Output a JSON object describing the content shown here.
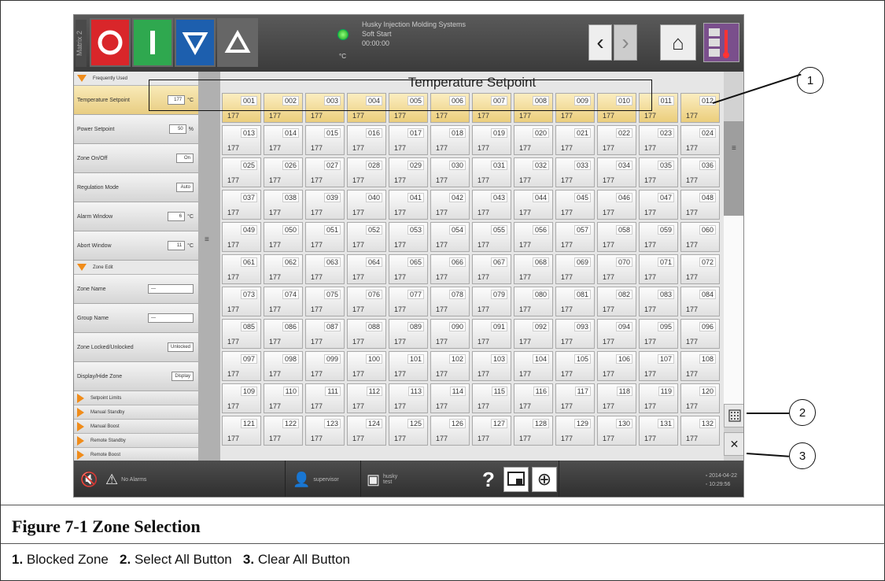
{
  "topbar": {
    "matrix_label": "Matrix 2",
    "status_company": "Husky Injection Molding Systems",
    "status_mode": "Soft Start",
    "status_time": "00:00:00",
    "status_unit": "°C"
  },
  "sidebar": {
    "frequently_used": "Frequently Used",
    "temperature_setpoint": {
      "label": "Temperature Setpoint",
      "value": "177",
      "unit": "°C"
    },
    "power_setpoint": {
      "label": "Power Setpoint",
      "value": "50",
      "unit": "%"
    },
    "zone_onoff": {
      "label": "Zone On/Off",
      "value": "On"
    },
    "regulation_mode": {
      "label": "Regulation Mode",
      "value": "Auto"
    },
    "alarm_window": {
      "label": "Alarm Window",
      "value": "6",
      "unit": "°C"
    },
    "abort_window": {
      "label": "Abort Window",
      "value": "11",
      "unit": "°C"
    },
    "zone_edit": "Zone Edit",
    "zone_name": {
      "label": "Zone Name",
      "value": "—"
    },
    "group_name": {
      "label": "Group Name",
      "value": "—"
    },
    "zone_locked": {
      "label": "Zone Locked/Unlocked",
      "value": "Unlocked"
    },
    "display_hide": {
      "label": "Display/Hide Zone",
      "value": "Display"
    },
    "sections": [
      "Setpoint Limits",
      "Manual Standby",
      "Manual Boost",
      "Remote Standby",
      "Remote Boost"
    ]
  },
  "main": {
    "title": "Temperature Setpoint",
    "zone_value": "177",
    "rows": [
      [
        "001",
        "002",
        "003",
        "004",
        "005",
        "006",
        "007",
        "008",
        "009",
        "010",
        "011",
        "012"
      ],
      [
        "013",
        "014",
        "015",
        "016",
        "017",
        "018",
        "019",
        "020",
        "021",
        "022",
        "023",
        "024"
      ],
      [
        "025",
        "026",
        "027",
        "028",
        "029",
        "030",
        "031",
        "032",
        "033",
        "034",
        "035",
        "036"
      ],
      [
        "037",
        "038",
        "039",
        "040",
        "041",
        "042",
        "043",
        "044",
        "045",
        "046",
        "047",
        "048"
      ],
      [
        "049",
        "050",
        "051",
        "052",
        "053",
        "054",
        "055",
        "056",
        "057",
        "058",
        "059",
        "060"
      ],
      [
        "061",
        "062",
        "063",
        "064",
        "065",
        "066",
        "067",
        "068",
        "069",
        "070",
        "071",
        "072"
      ],
      [
        "073",
        "074",
        "075",
        "076",
        "077",
        "078",
        "079",
        "080",
        "081",
        "082",
        "083",
        "084"
      ],
      [
        "085",
        "086",
        "087",
        "088",
        "089",
        "090",
        "091",
        "092",
        "093",
        "094",
        "095",
        "096"
      ],
      [
        "097",
        "098",
        "099",
        "100",
        "101",
        "102",
        "103",
        "104",
        "105",
        "106",
        "107",
        "108"
      ],
      [
        "109",
        "110",
        "111",
        "112",
        "113",
        "114",
        "115",
        "116",
        "117",
        "118",
        "119",
        "120"
      ],
      [
        "121",
        "122",
        "123",
        "124",
        "125",
        "126",
        "127",
        "128",
        "129",
        "130",
        "131",
        "132"
      ]
    ]
  },
  "bottombar": {
    "alarms": "No Alarms",
    "user": "supervisor",
    "mold_name": "husky",
    "mold_sub": "test",
    "date": "2014-04-22",
    "time": "10:29:56"
  },
  "callouts": {
    "one": "1",
    "two": "2",
    "three": "3"
  },
  "caption": {
    "title": "Figure 7-1    Zone Selection",
    "items": [
      {
        "num": "1.",
        "text": "Blocked Zone"
      },
      {
        "num": "2.",
        "text": "Select All Button"
      },
      {
        "num": "3.",
        "text": "Clear All Button"
      }
    ]
  }
}
